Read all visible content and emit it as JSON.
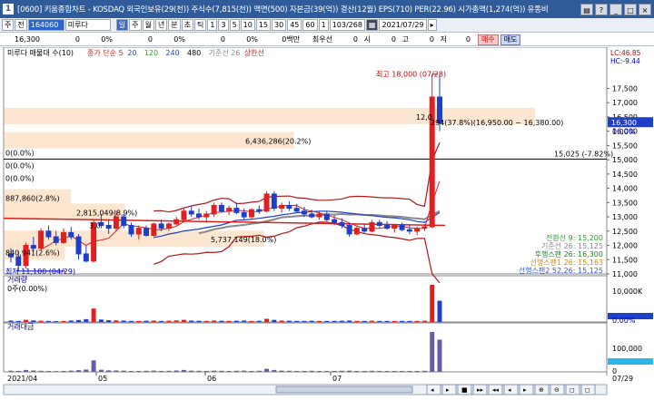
{
  "window": {
    "title": "[0600] 키움종합차트 - KOSDAQ 외국인보유(29(천)) 주식수(7,815(천)) 액면(500) 자본금(39(억)) 결산(12월) EPS(710) PER(22.96) 시가총액(1,274(억)) 유통비",
    "controls": [
      "▤",
      "?",
      "_",
      "□",
      "×"
    ]
  },
  "toolbar": {
    "period_select": "주",
    "mode_select": "전",
    "stock_code": "164060",
    "stock_name": "미루다",
    "intervals": [
      "일",
      "주",
      "월",
      "년",
      "분",
      "초",
      "틱"
    ],
    "active_interval": "일",
    "numbers": [
      "1",
      "3",
      "5",
      "10",
      "15",
      "30",
      "45",
      "60"
    ],
    "count_select": "1",
    "page": "103/268",
    "date": "2021/07/29"
  },
  "quote": {
    "price": "16,300",
    "change": "0",
    "change_pct": "0%",
    "volume": "0",
    "volume_pct": "0%",
    "val3": "0",
    "val3_pct": "0%",
    "market_cap_label": "0백만",
    "preferred_label": "최우선",
    "open": "0",
    "open_label": "시",
    "high": "0",
    "high_label": "고",
    "low": "0",
    "low_label": "저",
    "close": "0",
    "buy_label": "매수",
    "sell_label": "매도"
  },
  "colors": {
    "up": "#e02020",
    "down": "#1f3fc8",
    "ma5": "#e02020",
    "ma20": "#1f3fc8",
    "ma60": "#888888",
    "bollinger": "#b01818",
    "highlight": "#fde2c8",
    "ichimoku": "#d62020"
  },
  "chart_data": {
    "type": "candlestick",
    "price_panel": {
      "title": "미루다 매물대 수(10)",
      "legend": [
        {
          "label": "종가 단순 5",
          "color": "#e02020"
        },
        {
          "label": "20",
          "color": "#1f3fc8"
        },
        {
          "label": "120",
          "color": "#2aa02a"
        },
        {
          "label": "240",
          "color": "#1f3fc8"
        },
        {
          "label": "480",
          "color": "#000000"
        },
        {
          "label": "기준선 26",
          "color": "#888888"
        },
        {
          "label": "상한선",
          "color": "#e02020"
        }
      ],
      "ylim": [
        11000,
        18500
      ],
      "y_ticks": [
        11000,
        11500,
        12000,
        12500,
        13000,
        13500,
        14000,
        14500,
        15000,
        15500,
        16000,
        16500,
        17000,
        17500
      ],
      "top_labels": [
        "LC:46.85",
        "HC:-9.44"
      ],
      "current_price": 16300,
      "current_pct": "0.00%",
      "reference_line": {
        "value": 15025,
        "label": "15,025 (-7.82%)"
      },
      "high_annotation": "최고 18,000 (07/28)",
      "low_annotation": "최저 11,100 (04/29)",
      "volume_profile_labels": [
        {
          "price": 16500,
          "label": "12,0",
          "width": 0.88
        },
        {
          "price": 16300,
          "label": "294(37.8%)(16,950.00 ~ 16,380.00)",
          "width": 0
        },
        {
          "price": 15650,
          "label": "6,436,286(20.2%)",
          "width": 0.48
        },
        {
          "price": 15250,
          "label": "0(0.0%)",
          "width": 0
        },
        {
          "price": 14800,
          "label": "0(0.0%)",
          "width": 0
        },
        {
          "price": 14350,
          "label": "0(0.0%)",
          "width": 0
        },
        {
          "price": 13650,
          "label": "887,860(2.8%)",
          "width": 0.11
        },
        {
          "price": 13150,
          "label": "2,815,049(8.9%)",
          "width": 0.2
        },
        {
          "price": 12700,
          "label": "3,0",
          "width": 0.0
        },
        {
          "price": 12200,
          "label": "5,737,149(18.0%)",
          "width": 0.43
        },
        {
          "price": 11750,
          "label": "840,941(2.6%)",
          "width": 0.1
        }
      ],
      "indicator_values": [
        {
          "label": "전환선 9: 15,200",
          "color": "#2aa02a"
        },
        {
          "label": "기준선 26: 15,125",
          "color": "#888888"
        },
        {
          "label": "후행스팬 26: 16,300",
          "color": "#2a7a2a"
        },
        {
          "label": "선행스팬1 26: 15,163",
          "color": "#d08a20"
        },
        {
          "label": "선행스팬2 52,26: 15,125",
          "color": "#3a5ad0"
        }
      ]
    },
    "candles": [
      {
        "o": 11700,
        "h": 11900,
        "l": 11400,
        "c": 11600
      },
      {
        "o": 11600,
        "h": 11800,
        "l": 11100,
        "c": 11300
      },
      {
        "o": 11300,
        "h": 12100,
        "l": 11200,
        "c": 12000
      },
      {
        "o": 12000,
        "h": 12300,
        "l": 11800,
        "c": 11900
      },
      {
        "o": 11900,
        "h": 12600,
        "l": 11850,
        "c": 12500
      },
      {
        "o": 12500,
        "h": 12700,
        "l": 12200,
        "c": 12300
      },
      {
        "o": 12300,
        "h": 12500,
        "l": 12000,
        "c": 12100
      },
      {
        "o": 12100,
        "h": 12600,
        "l": 12050,
        "c": 12450
      },
      {
        "o": 12450,
        "h": 12650,
        "l": 12200,
        "c": 12300
      },
      {
        "o": 12300,
        "h": 12400,
        "l": 11500,
        "c": 11700
      },
      {
        "o": 11700,
        "h": 12000,
        "l": 11400,
        "c": 11450
      },
      {
        "o": 11450,
        "h": 12900,
        "l": 11400,
        "c": 12800
      },
      {
        "o": 12800,
        "h": 13100,
        "l": 12600,
        "c": 12700
      },
      {
        "o": 12700,
        "h": 12900,
        "l": 12400,
        "c": 12600
      },
      {
        "o": 12600,
        "h": 13200,
        "l": 12500,
        "c": 13000
      },
      {
        "o": 13000,
        "h": 13100,
        "l": 12600,
        "c": 12700
      },
      {
        "o": 12700,
        "h": 12800,
        "l": 12300,
        "c": 12400
      },
      {
        "o": 12400,
        "h": 12700,
        "l": 12200,
        "c": 12600
      },
      {
        "o": 12600,
        "h": 12700,
        "l": 12300,
        "c": 12350
      },
      {
        "o": 12350,
        "h": 12800,
        "l": 12300,
        "c": 12750
      },
      {
        "o": 12750,
        "h": 12900,
        "l": 12500,
        "c": 12600
      },
      {
        "o": 12600,
        "h": 12800,
        "l": 12500,
        "c": 12750
      },
      {
        "o": 12750,
        "h": 13000,
        "l": 12700,
        "c": 12900
      },
      {
        "o": 12900,
        "h": 13300,
        "l": 12800,
        "c": 13200
      },
      {
        "o": 13200,
        "h": 13400,
        "l": 13000,
        "c": 13100
      },
      {
        "o": 13100,
        "h": 13300,
        "l": 12900,
        "c": 13000
      },
      {
        "o": 13000,
        "h": 13200,
        "l": 12800,
        "c": 13100
      },
      {
        "o": 13100,
        "h": 13500,
        "l": 13000,
        "c": 13400
      },
      {
        "o": 13400,
        "h": 13500,
        "l": 13150,
        "c": 13200
      },
      {
        "o": 13200,
        "h": 13400,
        "l": 13050,
        "c": 13300
      },
      {
        "o": 13300,
        "h": 13500,
        "l": 13100,
        "c": 13150
      },
      {
        "o": 13150,
        "h": 13300,
        "l": 12900,
        "c": 13000
      },
      {
        "o": 13000,
        "h": 13300,
        "l": 12900,
        "c": 13250
      },
      {
        "o": 13250,
        "h": 13400,
        "l": 13100,
        "c": 13200
      },
      {
        "o": 13200,
        "h": 13900,
        "l": 13150,
        "c": 13800
      },
      {
        "o": 13800,
        "h": 13900,
        "l": 13200,
        "c": 13300
      },
      {
        "o": 13300,
        "h": 13500,
        "l": 13150,
        "c": 13400
      },
      {
        "o": 13400,
        "h": 13550,
        "l": 13200,
        "c": 13300
      },
      {
        "o": 13300,
        "h": 13450,
        "l": 13150,
        "c": 13200
      },
      {
        "o": 13200,
        "h": 13350,
        "l": 13000,
        "c": 13100
      },
      {
        "o": 13100,
        "h": 13250,
        "l": 12950,
        "c": 13000
      },
      {
        "o": 13000,
        "h": 13200,
        "l": 12900,
        "c": 13100
      },
      {
        "o": 13100,
        "h": 13200,
        "l": 12850,
        "c": 12900
      },
      {
        "o": 12900,
        "h": 13050,
        "l": 12700,
        "c": 12800
      },
      {
        "o": 12800,
        "h": 12950,
        "l": 12600,
        "c": 12700
      },
      {
        "o": 12700,
        "h": 12800,
        "l": 12300,
        "c": 12400
      },
      {
        "o": 12400,
        "h": 12700,
        "l": 12350,
        "c": 12600
      },
      {
        "o": 12600,
        "h": 12750,
        "l": 12400,
        "c": 12500
      },
      {
        "o": 12500,
        "h": 12900,
        "l": 12450,
        "c": 12800
      },
      {
        "o": 12800,
        "h": 12900,
        "l": 12600,
        "c": 12700
      },
      {
        "o": 12700,
        "h": 12850,
        "l": 12550,
        "c": 12600
      },
      {
        "o": 12600,
        "h": 12750,
        "l": 12450,
        "c": 12700
      },
      {
        "o": 12700,
        "h": 12800,
        "l": 12500,
        "c": 12550
      },
      {
        "o": 12550,
        "h": 12700,
        "l": 12400,
        "c": 12500
      },
      {
        "o": 12500,
        "h": 12650,
        "l": 12350,
        "c": 12600
      },
      {
        "o": 12600,
        "h": 12750,
        "l": 12500,
        "c": 12650
      },
      {
        "o": 12650,
        "h": 18000,
        "l": 12600,
        "c": 17200
      },
      {
        "o": 17200,
        "h": 18000,
        "l": 16000,
        "c": 16300
      }
    ],
    "x_labels": [
      "2021/04",
      "05",
      "06",
      "07",
      "07/29"
    ],
    "volume_panel": {
      "title": "거래량",
      "subtitle": "0주(0.00%)",
      "y_ticks": [
        "10,000K"
      ],
      "right_value": "0.00%",
      "values": [
        40,
        30,
        60,
        45,
        35,
        30,
        25,
        30,
        40,
        55,
        80,
        380,
        70,
        50,
        45,
        40,
        30,
        30,
        35,
        40,
        30,
        35,
        45,
        60,
        40,
        35,
        30,
        40,
        35,
        30,
        35,
        40,
        30,
        35,
        90,
        60,
        40,
        35,
        30,
        30,
        35,
        30,
        30,
        30,
        35,
        40,
        30,
        30,
        35,
        30,
        30,
        30,
        30,
        30,
        30,
        35,
        1050,
        600
      ]
    },
    "value_panel": {
      "title": "거래대금",
      "y_ticks": [
        "100,000"
      ],
      "right_value": "0",
      "values": [
        15,
        12,
        25,
        18,
        14,
        12,
        10,
        12,
        16,
        22,
        30,
        150,
        28,
        20,
        18,
        16,
        12,
        12,
        14,
        16,
        12,
        14,
        18,
        25,
        16,
        14,
        12,
        16,
        14,
        12,
        14,
        16,
        12,
        14,
        40,
        25,
        16,
        14,
        12,
        12,
        14,
        12,
        12,
        12,
        14,
        16,
        12,
        12,
        14,
        12,
        12,
        12,
        12,
        12,
        12,
        14,
        520,
        420
      ]
    }
  }
}
